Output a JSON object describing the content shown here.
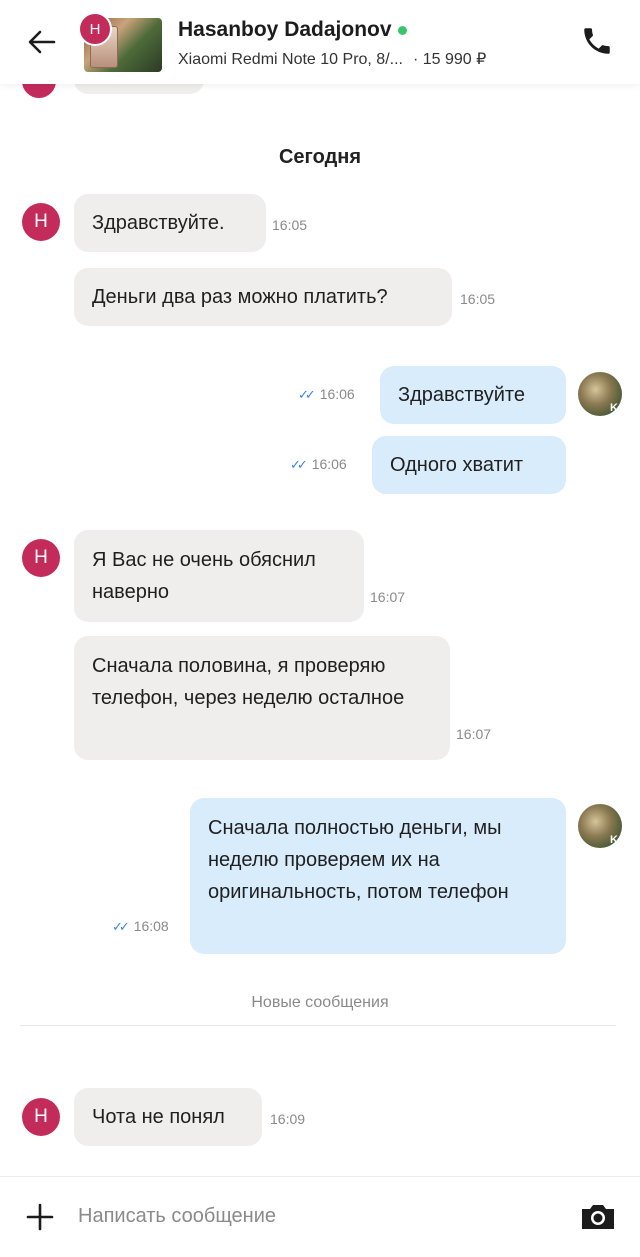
{
  "header": {
    "avatar_letter": "H",
    "name": "Hasanboy Dadajonov",
    "listing_title": "Xiaomi Redmi Note 10 Pro, 8/...",
    "price": "· 15 990 ₽"
  },
  "chat": {
    "date_separator": "Сегодня",
    "messages": [
      {
        "from": "them",
        "text": "Здравствуйте.",
        "time": "16:05"
      },
      {
        "from": "them",
        "text": "Деньги два раз можно платить?",
        "time": "16:05"
      },
      {
        "from": "me",
        "text": "Здравствуйте",
        "time": "16:06"
      },
      {
        "from": "me",
        "text": "Одного хватит",
        "time": "16:06"
      },
      {
        "from": "them",
        "text": "Я Вас не очень обяснил наверно",
        "time": "16:07"
      },
      {
        "from": "them",
        "text": "Сначала половина, я проверяю телефон, через неделю осталное",
        "time": "16:07"
      },
      {
        "from": "me",
        "text": "Сначала полностью деньги, мы неделю проверяем их на оригинальность, потом телефон",
        "time": "16:08"
      },
      {
        "from": "them",
        "text": "Чота не понял",
        "time": "16:09"
      }
    ],
    "new_messages_label": "Новые сообщения",
    "my_avatar_letter": "K"
  },
  "composer": {
    "placeholder": "Написать сообщение"
  },
  "colors": {
    "accent": "#c32b5b",
    "incoming_bubble": "#efeeec",
    "outgoing_bubble": "#d8ecfb",
    "online": "#3cc36e",
    "read_check": "#3b82f6"
  }
}
